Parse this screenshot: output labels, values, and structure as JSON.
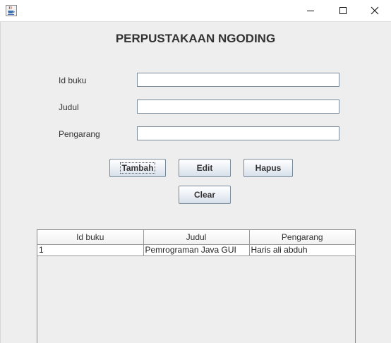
{
  "window": {
    "icon": "java-coffee-icon",
    "controls": {
      "minimize": "minimize-icon",
      "maximize": "maximize-icon",
      "close": "close-icon"
    }
  },
  "heading": "PERPUSTAKAAN NGODING",
  "form": {
    "id_label": "Id buku",
    "id_value": "",
    "judul_label": "Judul",
    "judul_value": "",
    "pengarang_label": "Pengarang",
    "pengarang_value": ""
  },
  "buttons": {
    "tambah": "Tambah",
    "edit": "Edit",
    "hapus": "Hapus",
    "clear": "Clear"
  },
  "table": {
    "headers": [
      "Id buku",
      "Judul",
      "Pengarang"
    ],
    "rows": [
      [
        "1",
        "Pemrograman Java GUI",
        "Haris ali abduh"
      ]
    ]
  }
}
